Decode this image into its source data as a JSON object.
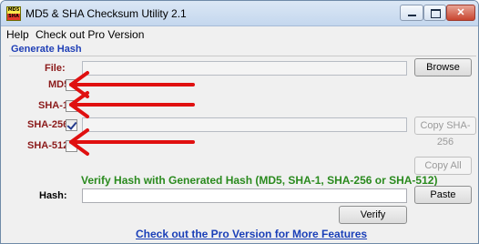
{
  "window": {
    "title": "MD5 & SHA Checksum Utility 2.1",
    "icon_text": "MD5 SHA"
  },
  "menu": {
    "items": [
      "Help",
      "Check out Pro Version"
    ]
  },
  "generate": {
    "group_title": "Generate Hash",
    "file_label": "File:",
    "browse_label": "Browse",
    "md5_label": "MD5",
    "md5_checked": false,
    "sha1_label": "SHA-1",
    "sha1_checked": false,
    "sha256_label": "SHA-256",
    "sha256_checked": true,
    "copy_sha256_label": "Copy SHA-256",
    "sha512_label": "SHA-512",
    "sha512_checked": false,
    "copy_all_label": "Copy All"
  },
  "verify": {
    "title": "Verify Hash with Generated Hash (MD5, SHA-1, SHA-256 or SHA-512)",
    "hash_label": "Hash:",
    "paste_label": "Paste",
    "verify_label": "Verify"
  },
  "footer": {
    "pro_link": "Check out the Pro Version for More Features"
  },
  "colors": {
    "annotation_arrow": "#e01010",
    "label_red": "#8b1a1a",
    "group_blue": "#1f3fb6",
    "verify_green": "#2a8a1e"
  },
  "icons": [
    "app-icon",
    "minimize-icon",
    "maximize-icon",
    "close-icon",
    "checkmark-icon",
    "arrow-annotation"
  ]
}
